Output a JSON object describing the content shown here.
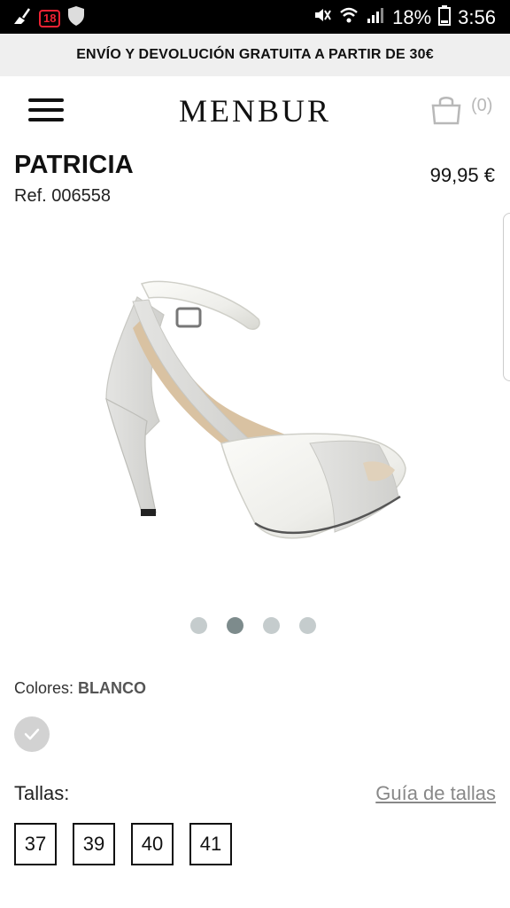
{
  "status_bar": {
    "notification_count": "18",
    "battery": "18%",
    "time": "3:56",
    "icons": [
      "broom-icon",
      "notification-badge-icon",
      "shield-icon",
      "mute-icon",
      "wifi-icon",
      "signal-icon",
      "battery-icon"
    ]
  },
  "promo": {
    "text": "ENVÍO Y DEVOLUCIÓN GRATUITA A PARTIR DE 30€"
  },
  "header": {
    "logo": "MENBUR",
    "cart_count": "(0)",
    "icons": [
      "menu-icon",
      "shopping-bag-icon"
    ]
  },
  "product": {
    "name": "PATRICIA",
    "ref": "Ref. 006558",
    "price": "99,95 €"
  },
  "gallery": {
    "image_count": 4,
    "active_index": 1
  },
  "colors": {
    "label": "Colores:",
    "selected": "BLANCO",
    "swatch_color": "#d2d2d2"
  },
  "sizes": {
    "label": "Tallas:",
    "guide_link": "Guía de tallas",
    "options": [
      "37",
      "39",
      "40",
      "41"
    ]
  },
  "theme": {
    "dot_inactive": "#c5cccd",
    "dot_active": "#7d8b8c",
    "promo_bg": "#efefef"
  }
}
